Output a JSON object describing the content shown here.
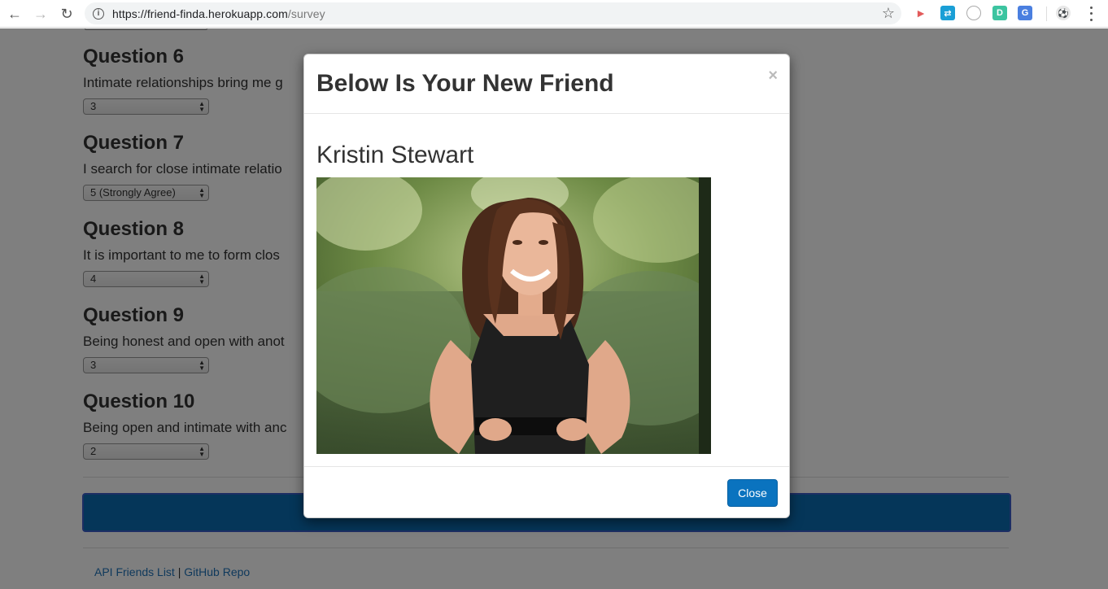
{
  "browser": {
    "url_host": "https://friend-finda.herokuapp.com",
    "url_path": "/survey"
  },
  "questions": [
    {
      "title": "Question 6",
      "text": "Intimate relationships bring me g",
      "value": "3"
    },
    {
      "title": "Question 7",
      "text": "I search for close intimate relatio",
      "value": "5 (Strongly Agree)"
    },
    {
      "title": "Question 8",
      "text": "It is important to me to form clos",
      "value": "4"
    },
    {
      "title": "Question 9",
      "text": "Being honest and open with anot",
      "value": "3"
    },
    {
      "title": "Question 10",
      "text": "Being open and intimate with anc",
      "value": "2"
    }
  ],
  "footer": {
    "link1": "API Friends List",
    "separator": "|",
    "link2": "GitHub Repo"
  },
  "modal": {
    "title": "Below Is Your New Friend",
    "close_x": "×",
    "friend_name": "Kristin Stewart",
    "close_label": "Close"
  },
  "colors": {
    "accent": "#0a73bf",
    "submit_bar": "#0a6db3"
  }
}
